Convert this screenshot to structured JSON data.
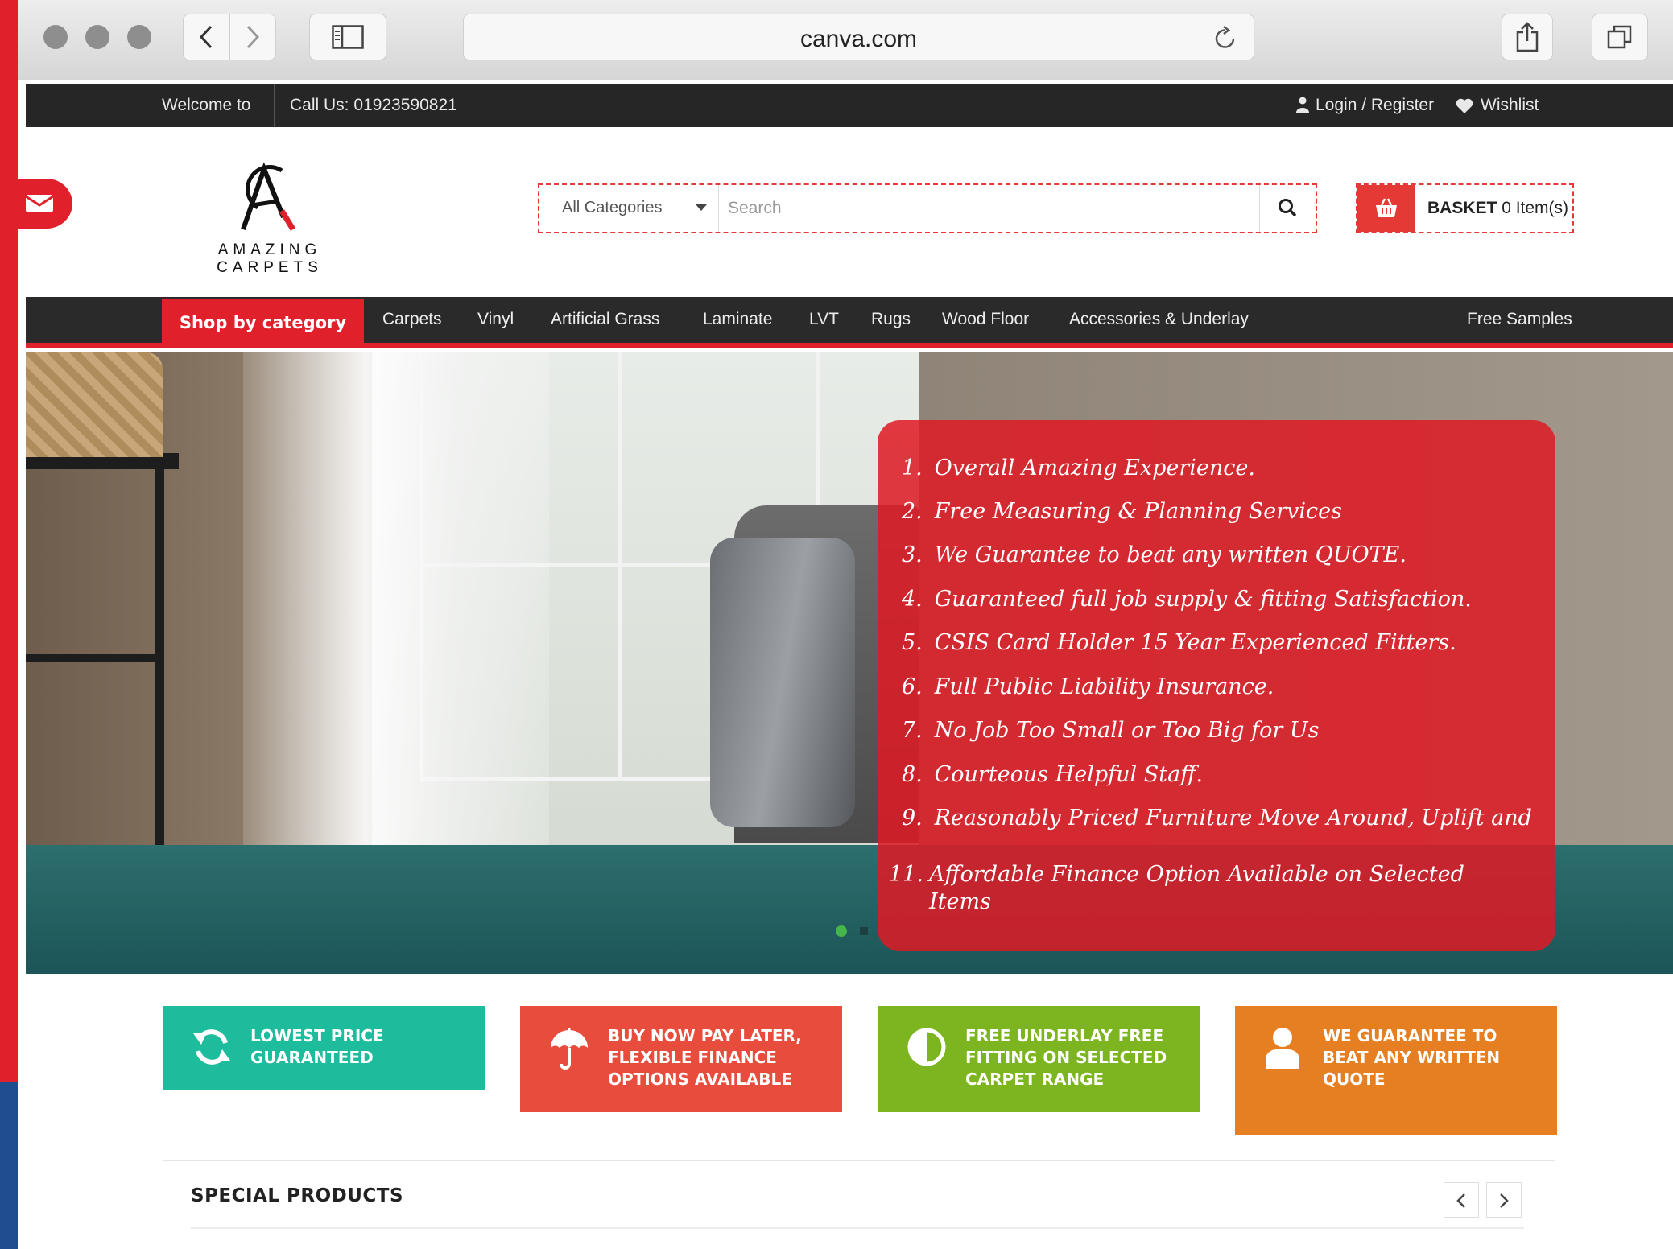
{
  "browser": {
    "address": "canva.com"
  },
  "topbar": {
    "welcome": "Welcome to",
    "call": "Call Us: 01923590821",
    "login": "Login / Register",
    "wishlist": "Wishlist"
  },
  "header": {
    "logo_text": "AMAZING CARPETS",
    "category_label": "All Categories",
    "search_placeholder": "Search",
    "basket_label": "BASKET",
    "basket_count": "0 Item(s)"
  },
  "nav": {
    "shop_by_category": "Shop by category",
    "items": [
      "Carpets",
      "Vinyl",
      "Artificial Grass",
      "Laminate",
      "LVT",
      "Rugs",
      "Wood Floor",
      "Accessories & Underlay"
    ],
    "free_samples": "Free Samples"
  },
  "hero": {
    "promo_items": [
      {
        "num": "1.",
        "text": "Overall Amazing Experience."
      },
      {
        "num": "2.",
        "text": "Free Measuring & Planning Services"
      },
      {
        "num": "3.",
        "text": "We Guarantee to beat any written QUOTE."
      },
      {
        "num": "4.",
        "text": "Guaranteed full job supply & fitting Satisfaction."
      },
      {
        "num": "5.",
        "text": "CSIS Card Holder 15 Year Experienced Fitters."
      },
      {
        "num": "6.",
        "text": "Full Public Liability Insurance."
      },
      {
        "num": "7.",
        "text": "No Job Too Small or Too Big for Us"
      },
      {
        "num": "8.",
        "text": "Courteous Helpful Staff."
      },
      {
        "num": "9.",
        "text": "Reasonably Priced Furniture Move Around, Uplift and"
      },
      {
        "num": "11.",
        "text": "Affordable Finance Option Available on Selected Items"
      }
    ],
    "slide_count": 2,
    "active_slide": 1
  },
  "features": [
    {
      "text": "Lowest Price Guaranteed",
      "icon": "refresh-icon",
      "color": "#1dbc9c"
    },
    {
      "text": "Buy Now Pay Later, Flexible Finance Options Available",
      "icon": "umbrella-icon",
      "color": "#e74c3c"
    },
    {
      "text": "Free Underlay Free Fitting on Selected Carpet Range",
      "icon": "half-circle-icon",
      "color": "#7cb51f"
    },
    {
      "text": "We Guarantee to Beat Any Written Quote",
      "icon": "user-icon",
      "color": "#e67e22"
    }
  ],
  "special": {
    "title": "SPECIAL PRODUCTS"
  },
  "colors": {
    "brand_red": "#e0202a",
    "dark_bar": "#262626"
  }
}
